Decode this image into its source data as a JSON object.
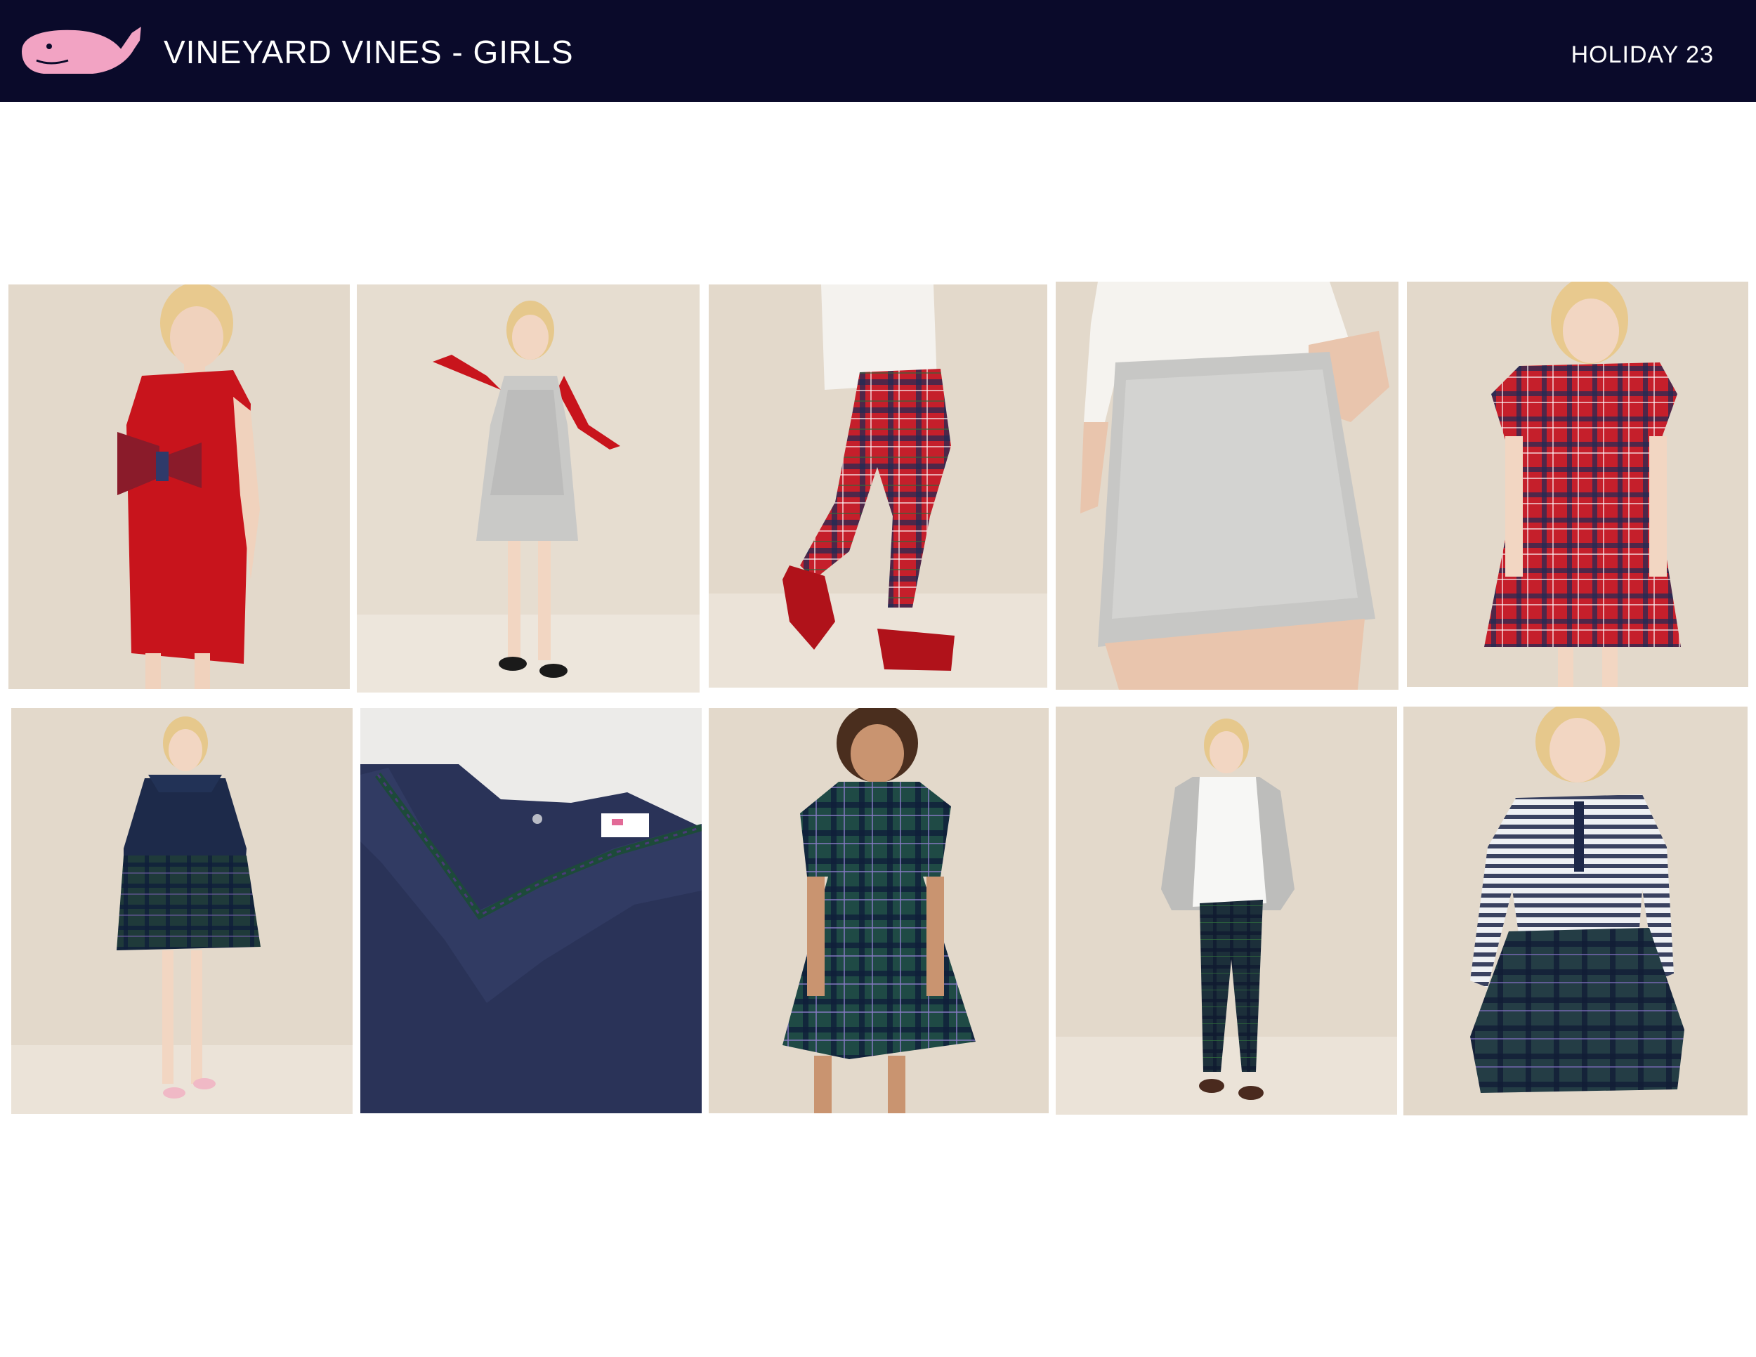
{
  "header": {
    "brand_title": "VINEYARD VINES - GIRLS",
    "season": "HOLIDAY 23",
    "logo_icon": "pink-whale-logo-icon",
    "background_color": "#0a0a2a",
    "logo_color": "#f2a3c3"
  },
  "gallery": {
    "rows": 2,
    "columns": 5,
    "items": [
      {
        "icon": "red-bow-dress-photo"
      },
      {
        "icon": "silver-sequin-dress-photo"
      },
      {
        "icon": "red-plaid-leggings-photo"
      },
      {
        "icon": "silver-sequin-skirt-photo"
      },
      {
        "icon": "red-plaid-puff-sleeve-dress-photo"
      },
      {
        "icon": "navy-sweater-green-plaid-skirt-photo"
      },
      {
        "icon": "navy-ruffle-collar-closeup-photo"
      },
      {
        "icon": "green-plaid-dress-photo"
      },
      {
        "icon": "white-shirt-plaid-pants-photo"
      },
      {
        "icon": "striped-henley-plaid-skirt-photo"
      }
    ]
  }
}
